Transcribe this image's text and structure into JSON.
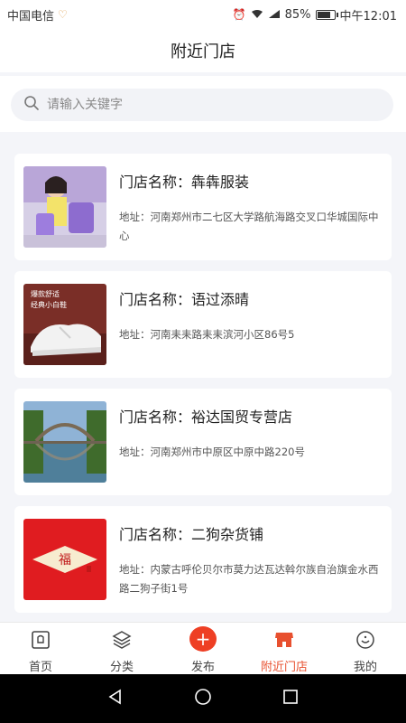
{
  "status_bar": {
    "carrier": "中国电信",
    "battery": "85%",
    "battery_level": 0.85,
    "time": "中午12:01"
  },
  "header": {
    "title": "附近门店"
  },
  "search": {
    "placeholder": "请输入关键字",
    "value": ""
  },
  "stores": [
    {
      "name": "门店名称：犇犇服装",
      "address": "地址：河南郑州市二七区大学路航海路交叉口华城国际中心",
      "thumb": "person-with-purple-bags"
    },
    {
      "name": "门店名称：语过添晴",
      "address": "地址：河南耒耒路耒耒滨河小区86号5",
      "thumb": "white-sneaker"
    },
    {
      "name": "门店名称：裕达国贸专营店",
      "address": "地址：河南郑州市中原区中原中路220号",
      "thumb": "bridge-lake"
    },
    {
      "name": "门店名称：二狗杂货铺",
      "address": "地址：内蒙古呼伦贝尔市莫力达瓦达斡尔族自治旗金水西路二狗子街1号",
      "thumb": "red-fu-logo"
    }
  ],
  "thumb_texts": {
    "sneaker_banner_line1": "爆款舒适",
    "sneaker_banner_line2": "经典小白鞋",
    "fu_char": "福"
  },
  "nav": {
    "items": [
      {
        "label": "首页",
        "icon": "home-icon"
      },
      {
        "label": "分类",
        "icon": "layers-icon"
      },
      {
        "label": "发布",
        "icon": "plus-icon",
        "symbol": "+"
      },
      {
        "label": "附近门店",
        "icon": "store-icon"
      },
      {
        "label": "我的",
        "icon": "profile-icon"
      }
    ],
    "active": "附近门店"
  },
  "colors": {
    "accent": "#e8502f",
    "publish": "#ee3f24"
  }
}
